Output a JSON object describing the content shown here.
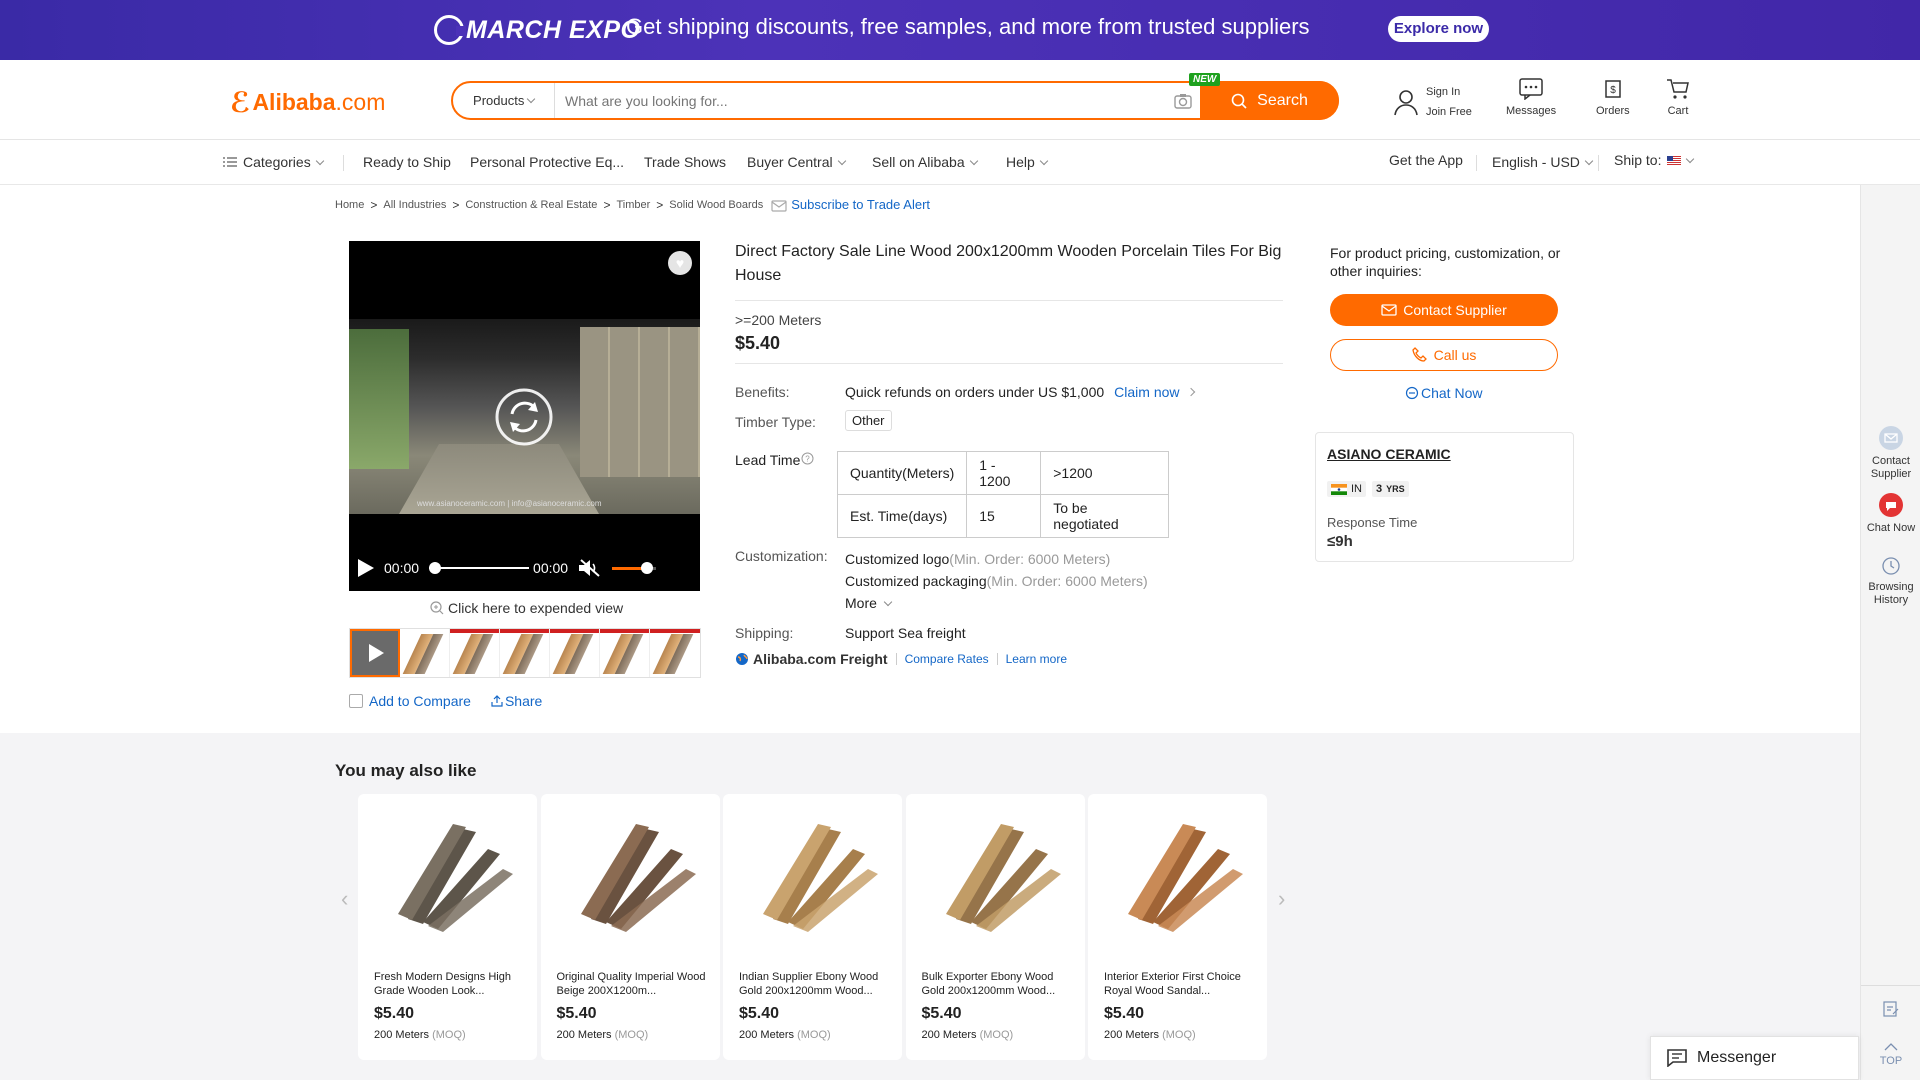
{
  "banner": {
    "logo": "MARCH EXPO",
    "message": "Get shipping discounts, free samples, and more from trusted suppliers",
    "cta": "Explore now"
  },
  "header": {
    "brand_glyph": "ℰ",
    "brand_name": "Alibaba",
    "brand_suffix": ".com",
    "product_type": "Products",
    "search_placeholder": "What are you looking for...",
    "new_badge": "NEW",
    "search_button": "Search",
    "sign_in": "Sign In",
    "join_free": "Join Free",
    "messages": "Messages",
    "orders": "Orders",
    "cart": "Cart"
  },
  "nav": {
    "categories": "Categories",
    "ready_to_ship": "Ready to Ship",
    "ppe": "Personal Protective Eq...",
    "trade_shows": "Trade Shows",
    "buyer_central": "Buyer Central",
    "sell": "Sell on Alibaba",
    "help": "Help",
    "get_app": "Get the App",
    "language": "English - USD",
    "ship_to": "Ship to:"
  },
  "breadcrumb": {
    "items": [
      "Home",
      "All Industries",
      "Construction & Real Estate",
      "Timber",
      "Solid Wood Boards"
    ],
    "separator": ">",
    "subscribe": "Subscribe to Trade Alert"
  },
  "media": {
    "watermark": "www.asianoceramic.com | info@asianoceramic.com",
    "time_current": "00:00",
    "time_total": "00:00",
    "progress": 0,
    "volume": 0.8,
    "expand": "Click here to expended view",
    "add_compare": "Add to Compare",
    "share": "Share"
  },
  "product": {
    "title": "Direct Factory Sale Line Wood 200x1200mm Wooden Porcelain Tiles For Big House",
    "moq": ">=200 Meters",
    "price": "$5.40",
    "benefits_label": "Benefits:",
    "benefits_text": "Quick refunds on orders under US $1,000",
    "claim": "Claim now",
    "timber_label": "Timber Type:",
    "timber_value": "Other",
    "lead_label": "Lead Time",
    "lead_table": {
      "row1": [
        "Quantity(Meters)",
        "1 - 1200",
        ">1200"
      ],
      "row2": [
        "Est. Time(days)",
        "15",
        "To be negotiated"
      ]
    },
    "custom_label": "Customization:",
    "custom1": "Customized logo",
    "custom1_note": "(Min. Order: 6000 Meters)",
    "custom2": "Customized packaging",
    "custom2_note": "(Min. Order: 6000 Meters)",
    "more": "More",
    "shipping_label": "Shipping:",
    "shipping_value": "Support Sea freight",
    "freight": "Alibaba.com Freight",
    "compare_rates": "Compare Rates",
    "learn_more": "Learn more"
  },
  "supplier": {
    "inquiry": "For product pricing, customization, or other inquiries:",
    "contact": "Contact Supplier",
    "call": "Call us",
    "chat": "Chat Now",
    "name": "ASIANO CERAMIC",
    "country": "IN",
    "years": "3",
    "years_unit": "YRS",
    "response_label": "Response Time",
    "response_value": "≤9h"
  },
  "rail": {
    "contact": "Contact Supplier",
    "chat": "Chat Now",
    "history": "Browsing History",
    "top": "TOP"
  },
  "recs": {
    "heading": "You may also like",
    "items": [
      {
        "name": "Fresh Modern Designs High Grade Wooden Look...",
        "price": "$5.40",
        "qty": "200 Meters",
        "moq": "(MOQ)"
      },
      {
        "name": "Original Quality Imperial Wood Beige 200X1200m...",
        "price": "$5.40",
        "qty": "200 Meters",
        "moq": "(MOQ)"
      },
      {
        "name": "Indian Supplier Ebony Wood Gold 200x1200mm Wood...",
        "price": "$5.40",
        "qty": "200 Meters",
        "moq": "(MOQ)"
      },
      {
        "name": "Bulk Exporter Ebony Wood Gold 200x1200mm Wood...",
        "price": "$5.40",
        "qty": "200 Meters",
        "moq": "(MOQ)"
      },
      {
        "name": "Interior Exterior First Choice Royal Wood Sandal...",
        "price": "$5.40",
        "qty": "200 Meters",
        "moq": "(MOQ)"
      }
    ]
  },
  "messenger": "Messenger",
  "colors": {
    "accent": "#ff6a00",
    "link": "#1467c7",
    "banner": "#4c32b8"
  }
}
